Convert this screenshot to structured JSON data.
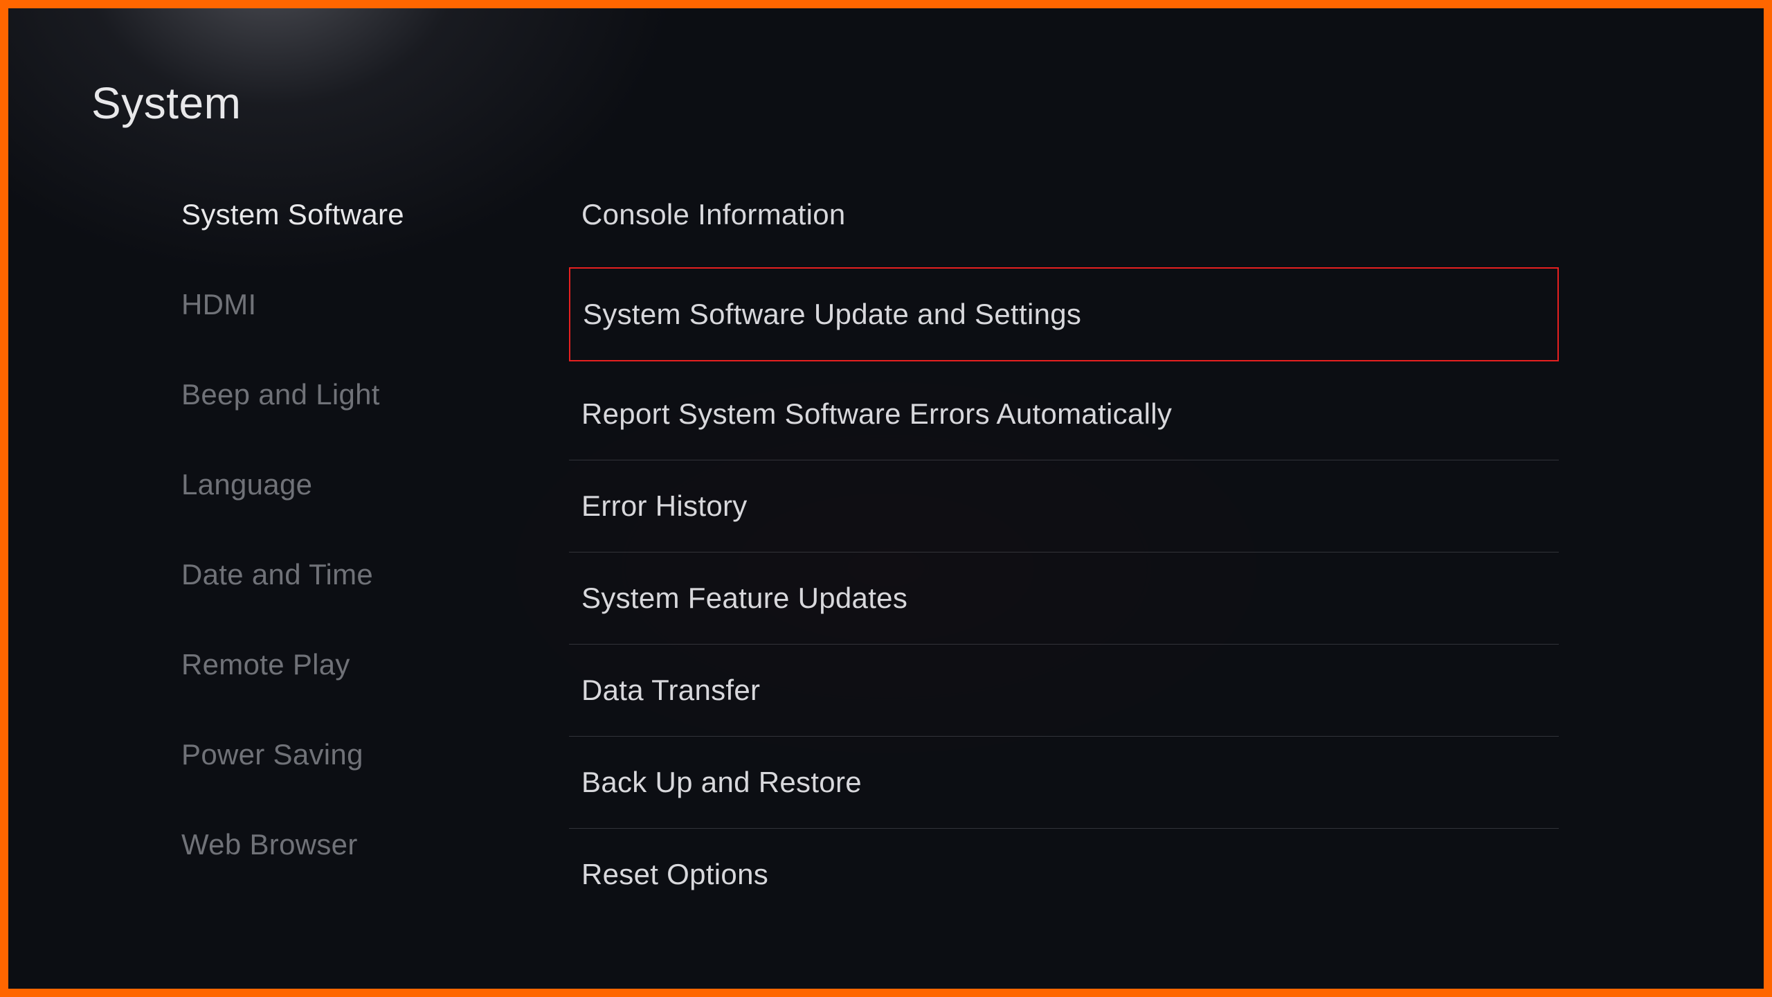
{
  "page": {
    "title": "System"
  },
  "sidebar": {
    "items": [
      {
        "label": "System Software",
        "active": true
      },
      {
        "label": "HDMI",
        "active": false
      },
      {
        "label": "Beep and Light",
        "active": false
      },
      {
        "label": "Language",
        "active": false
      },
      {
        "label": "Date and Time",
        "active": false
      },
      {
        "label": "Remote Play",
        "active": false
      },
      {
        "label": "Power Saving",
        "active": false
      },
      {
        "label": "Web Browser",
        "active": false
      }
    ]
  },
  "main": {
    "items": [
      {
        "label": "Console Information",
        "highlighted": false
      },
      {
        "label": "System Software Update and Settings",
        "highlighted": true
      },
      {
        "label": "Report System Software Errors Automatically",
        "highlighted": false
      },
      {
        "label": "Error History",
        "highlighted": false
      },
      {
        "label": "System Feature Updates",
        "highlighted": false
      },
      {
        "label": "Data Transfer",
        "highlighted": false
      },
      {
        "label": "Back Up and Restore",
        "highlighted": false
      },
      {
        "label": "Reset Options",
        "highlighted": false
      }
    ]
  },
  "colors": {
    "frame_border": "#ff6600",
    "highlight_border": "#e62020",
    "background": "#0c0e13"
  }
}
